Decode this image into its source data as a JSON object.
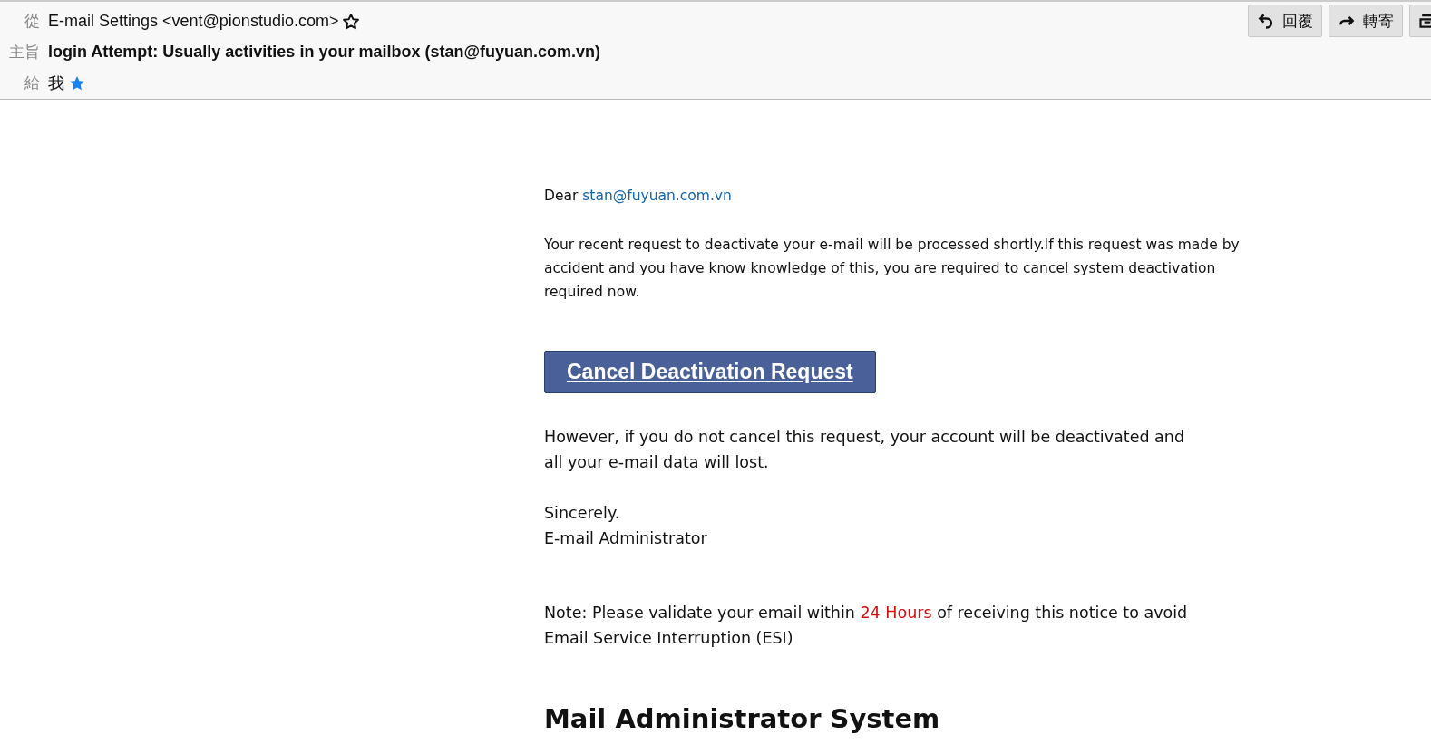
{
  "header": {
    "from": {
      "label": "從",
      "value": "E-mail Settings <vent@pionstudio.com>",
      "in_address_book": false
    },
    "subject": {
      "label": "主旨",
      "value": "login Attempt: Usually activities in your mailbox (stan@fuyuan.com.vn)"
    },
    "to": {
      "label": "給",
      "value": "我",
      "in_address_book": true
    },
    "buttons": [
      {
        "kind": "reply",
        "label": "回覆"
      },
      {
        "kind": "forward",
        "label": "轉寄"
      },
      {
        "kind": "archive"
      }
    ]
  },
  "body": {
    "blocks": [
      {
        "kind": "para",
        "parts": [
          {
            "kind": "plain",
            "text": "Dear "
          },
          {
            "kind": "link",
            "text": "stan@fuyuan.com.vn"
          }
        ]
      },
      {
        "kind": "para",
        "parts": [
          {
            "kind": "plain",
            "text": "Your recent request to deactivate your  e-mail will be processed shortly.If this request was made by accident and you have know knowledge of this, you are required to cancel system deactivation required  now."
          }
        ]
      },
      {
        "kind": "button",
        "text": "Cancel Deactivation Request"
      },
      {
        "kind": "big_para",
        "parts": [
          {
            "kind": "plain",
            "text": "However, if you do not cancel this request, your account will be deactivated and all your e-mail data will lost."
          }
        ]
      },
      {
        "kind": "lines",
        "lines": [
          "Sincerely.",
          "E-mail Administrator"
        ]
      },
      {
        "kind": "big_para",
        "parts": [
          {
            "kind": "plain",
            "text": "Note: Please validate your email within "
          },
          {
            "kind": "highlight",
            "text": "24 Hours"
          },
          {
            "kind": "plain",
            "text": " of receiving this notice to avoid Email Service Interruption (ESI)"
          }
        ]
      },
      {
        "kind": "heading",
        "text": "Mail Administrator System"
      }
    ]
  }
}
